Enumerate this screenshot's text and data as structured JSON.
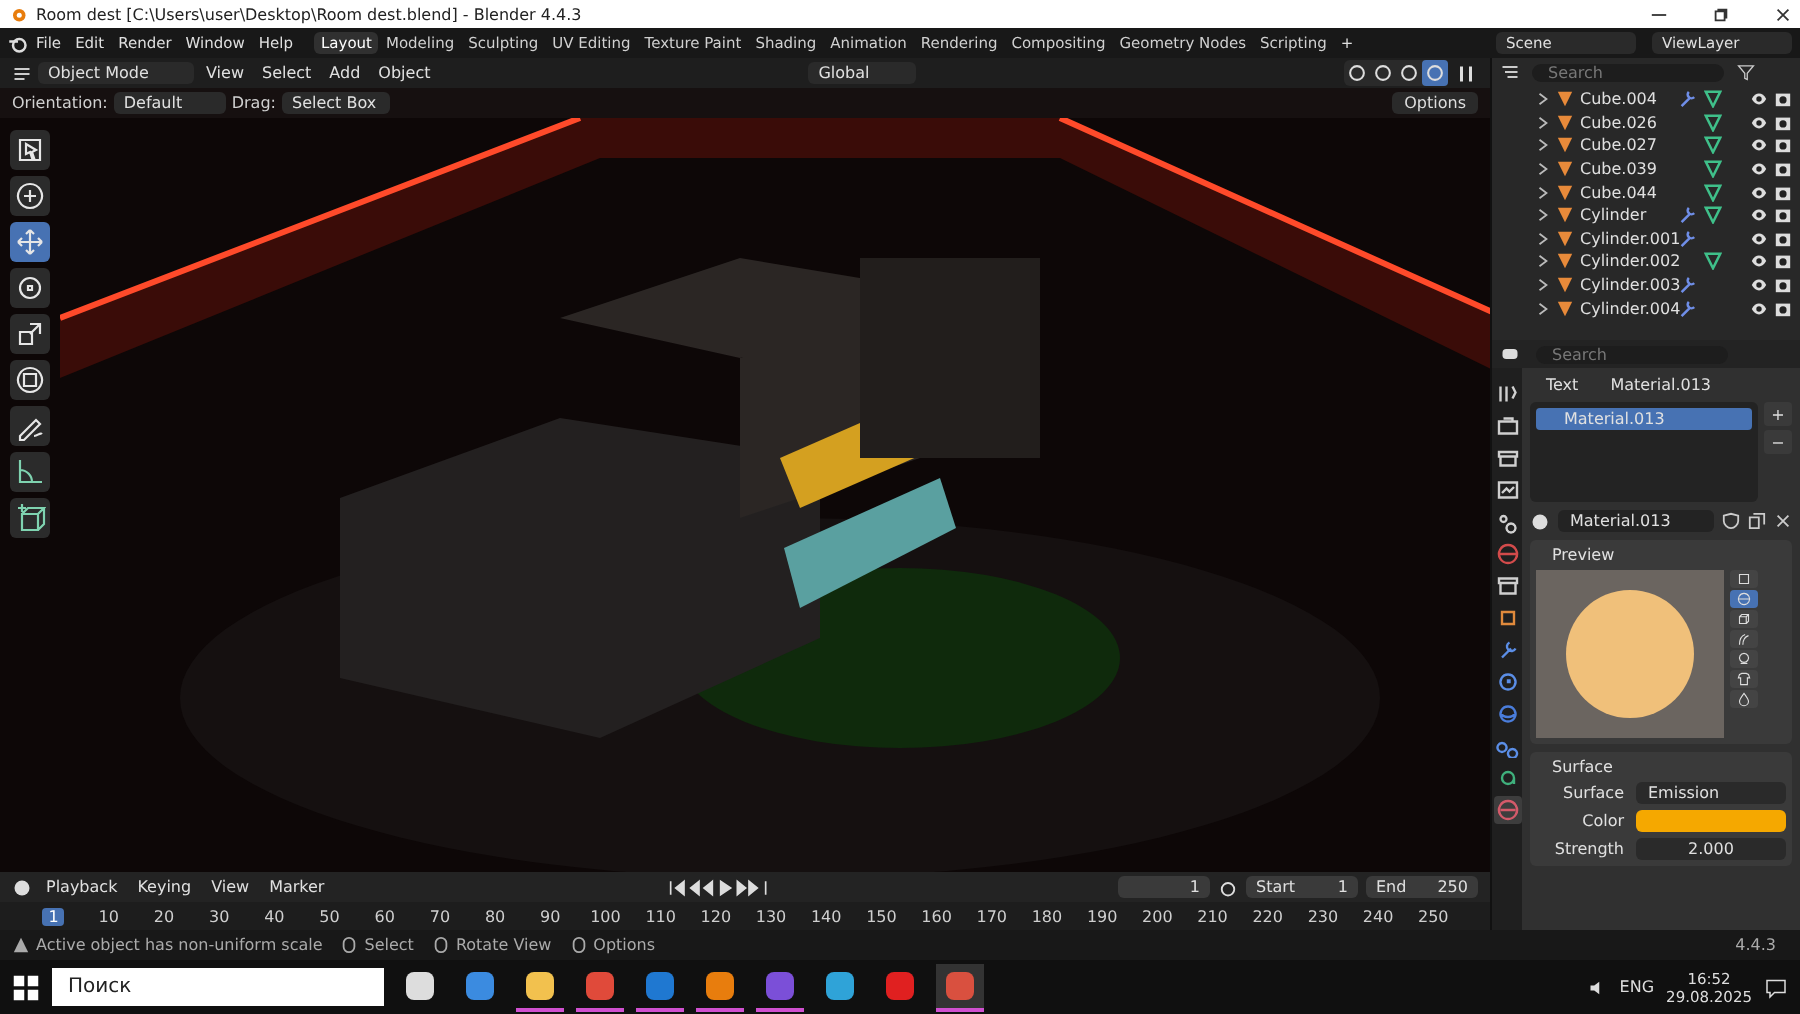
{
  "title_bar": {
    "title": "Room dest [C:\\Users\\user\\Desktop\\Room dest.blend] - Blender 4.4.3"
  },
  "menu": [
    "File",
    "Edit",
    "Render",
    "Window",
    "Help"
  ],
  "workspaces": [
    {
      "label": "Layout",
      "selected": true
    },
    {
      "label": "Modeling",
      "selected": false
    },
    {
      "label": "Sculpting",
      "selected": false
    },
    {
      "label": "UV Editing",
      "selected": false
    },
    {
      "label": "Texture Paint",
      "selected": false
    },
    {
      "label": "Shading",
      "selected": false
    },
    {
      "label": "Animation",
      "selected": false
    },
    {
      "label": "Rendering",
      "selected": false
    },
    {
      "label": "Compositing",
      "selected": false
    },
    {
      "label": "Geometry Nodes",
      "selected": false
    },
    {
      "label": "Scripting",
      "selected": false
    }
  ],
  "add_workspace": "+",
  "scene": "Scene",
  "view_layer": "ViewLayer",
  "viewport_header": {
    "mode": "Object Mode",
    "menus": [
      "View",
      "Select",
      "Add",
      "Object"
    ],
    "transform_orientation": "Global",
    "shading": [
      {
        "selected": false
      },
      {
        "selected": false
      },
      {
        "selected": false
      },
      {
        "selected": true
      }
    ]
  },
  "tool_settings": {
    "orientation_label": "Orientation:",
    "orientation": "Default",
    "drag_label": "Drag:",
    "drag": "Select Box",
    "options": "Options"
  },
  "tools": [
    {
      "kind": "select",
      "selected": false
    },
    {
      "kind": "cursor",
      "selected": false
    },
    {
      "kind": "move",
      "selected": true
    },
    {
      "kind": "rotate",
      "selected": false
    },
    {
      "kind": "scale",
      "selected": false
    },
    {
      "kind": "transform",
      "selected": false
    },
    {
      "kind": "annotate",
      "selected": false
    },
    {
      "kind": "measure",
      "selected": false
    },
    {
      "kind": "add",
      "selected": false
    }
  ],
  "outliner": {
    "search_placeholder": "Search",
    "items": [
      {
        "name": "Cube.004",
        "modifier": true,
        "mesh": true
      },
      {
        "name": "Cube.026",
        "modifier": false,
        "mesh": true
      },
      {
        "name": "Cube.027",
        "modifier": false,
        "mesh": true
      },
      {
        "name": "Cube.039",
        "modifier": false,
        "mesh": true
      },
      {
        "name": "Cube.044",
        "modifier": false,
        "mesh": true
      },
      {
        "name": "Cylinder",
        "modifier": true,
        "mesh": true
      },
      {
        "name": "Cylinder.001",
        "modifier": true,
        "mesh": false
      },
      {
        "name": "Cylinder.002",
        "modifier": false,
        "mesh": true
      },
      {
        "name": "Cylinder.003",
        "modifier": true,
        "mesh": false
      },
      {
        "name": "Cylinder.004",
        "modifier": true,
        "mesh": false
      }
    ]
  },
  "properties": {
    "search_placeholder": "Search",
    "tabs": [
      {
        "kind": "tool",
        "selected": false
      },
      {
        "kind": "render",
        "selected": false
      },
      {
        "kind": "output",
        "selected": false
      },
      {
        "kind": "view",
        "selected": false
      },
      {
        "kind": "scene",
        "selected": false
      },
      {
        "kind": "world",
        "selected": false
      },
      {
        "kind": "collection",
        "selected": false
      },
      {
        "kind": "object",
        "selected": false
      },
      {
        "kind": "modifier",
        "selected": false
      },
      {
        "kind": "particles",
        "selected": false
      },
      {
        "kind": "physics",
        "selected": false
      },
      {
        "kind": "constraints",
        "selected": false
      },
      {
        "kind": "data",
        "selected": false
      },
      {
        "kind": "material",
        "selected": true
      }
    ],
    "breadcrumb": [
      "Text",
      "Material.013"
    ],
    "slots": [
      {
        "name": "Material.013",
        "selected": true
      }
    ],
    "slot_add": "+",
    "slot_remove": "−",
    "material_name": "Material.013",
    "preview_title": "Preview",
    "preview_shapes": [
      {
        "kind": "plane",
        "selected": false
      },
      {
        "kind": "sphere",
        "selected": true
      },
      {
        "kind": "cube",
        "selected": false
      },
      {
        "kind": "hair",
        "selected": false
      },
      {
        "kind": "monkey",
        "selected": false
      },
      {
        "kind": "cloth",
        "selected": false
      },
      {
        "kind": "fluid",
        "selected": false
      }
    ],
    "surface_title": "Surface",
    "surface_label": "Surface",
    "surface_value": "Emission",
    "color_label": "Color",
    "color": "#f5a800",
    "strength_label": "Strength",
    "strength": "2.000"
  },
  "timeline": {
    "menus": [
      "Playback",
      "Keying",
      "View",
      "Marker"
    ],
    "current_frame": "1",
    "start_label": "Start",
    "start": "1",
    "end_label": "End",
    "end": "250",
    "ticks": [
      {
        "label": "1",
        "selected": true
      },
      {
        "label": "10",
        "selected": false
      },
      {
        "label": "20",
        "selected": false
      },
      {
        "label": "30",
        "selected": false
      },
      {
        "label": "40",
        "selected": false
      },
      {
        "label": "50",
        "selected": false
      },
      {
        "label": "60",
        "selected": false
      },
      {
        "label": "70",
        "selected": false
      },
      {
        "label": "80",
        "selected": false
      },
      {
        "label": "90",
        "selected": false
      },
      {
        "label": "100",
        "selected": false
      },
      {
        "label": "110",
        "selected": false
      },
      {
        "label": "120",
        "selected": false
      },
      {
        "label": "130",
        "selected": false
      },
      {
        "label": "140",
        "selected": false
      },
      {
        "label": "150",
        "selected": false
      },
      {
        "label": "160",
        "selected": false
      },
      {
        "label": "170",
        "selected": false
      },
      {
        "label": "180",
        "selected": false
      },
      {
        "label": "190",
        "selected": false
      },
      {
        "label": "200",
        "selected": false
      },
      {
        "label": "210",
        "selected": false
      },
      {
        "label": "220",
        "selected": false
      },
      {
        "label": "230",
        "selected": false
      },
      {
        "label": "240",
        "selected": false
      },
      {
        "label": "250",
        "selected": false
      }
    ]
  },
  "status_bar": {
    "warning": "Active object has non-uniform scale",
    "hints": [
      "Select",
      "Rotate View",
      "Options"
    ],
    "version": "4.4.3"
  },
  "taskbar": {
    "search_placeholder": "Поиск",
    "apps": [
      {
        "kind": "taskview",
        "running": false,
        "selected": false
      },
      {
        "kind": "store",
        "running": false,
        "selected": false
      },
      {
        "kind": "folder",
        "running": true,
        "selected": false
      },
      {
        "kind": "chrome",
        "running": true,
        "selected": false
      },
      {
        "kind": "mail",
        "running": true,
        "selected": false
      },
      {
        "kind": "blender",
        "running": true,
        "selected": false
      },
      {
        "kind": "purple",
        "running": true,
        "selected": false
      },
      {
        "kind": "edge",
        "running": false,
        "selected": false
      },
      {
        "kind": "yandex",
        "running": false,
        "selected": false
      },
      {
        "kind": "tool",
        "running": true,
        "selected": true
      }
    ],
    "language": "ENG",
    "time": "16:52",
    "date": "29.08.2025"
  }
}
